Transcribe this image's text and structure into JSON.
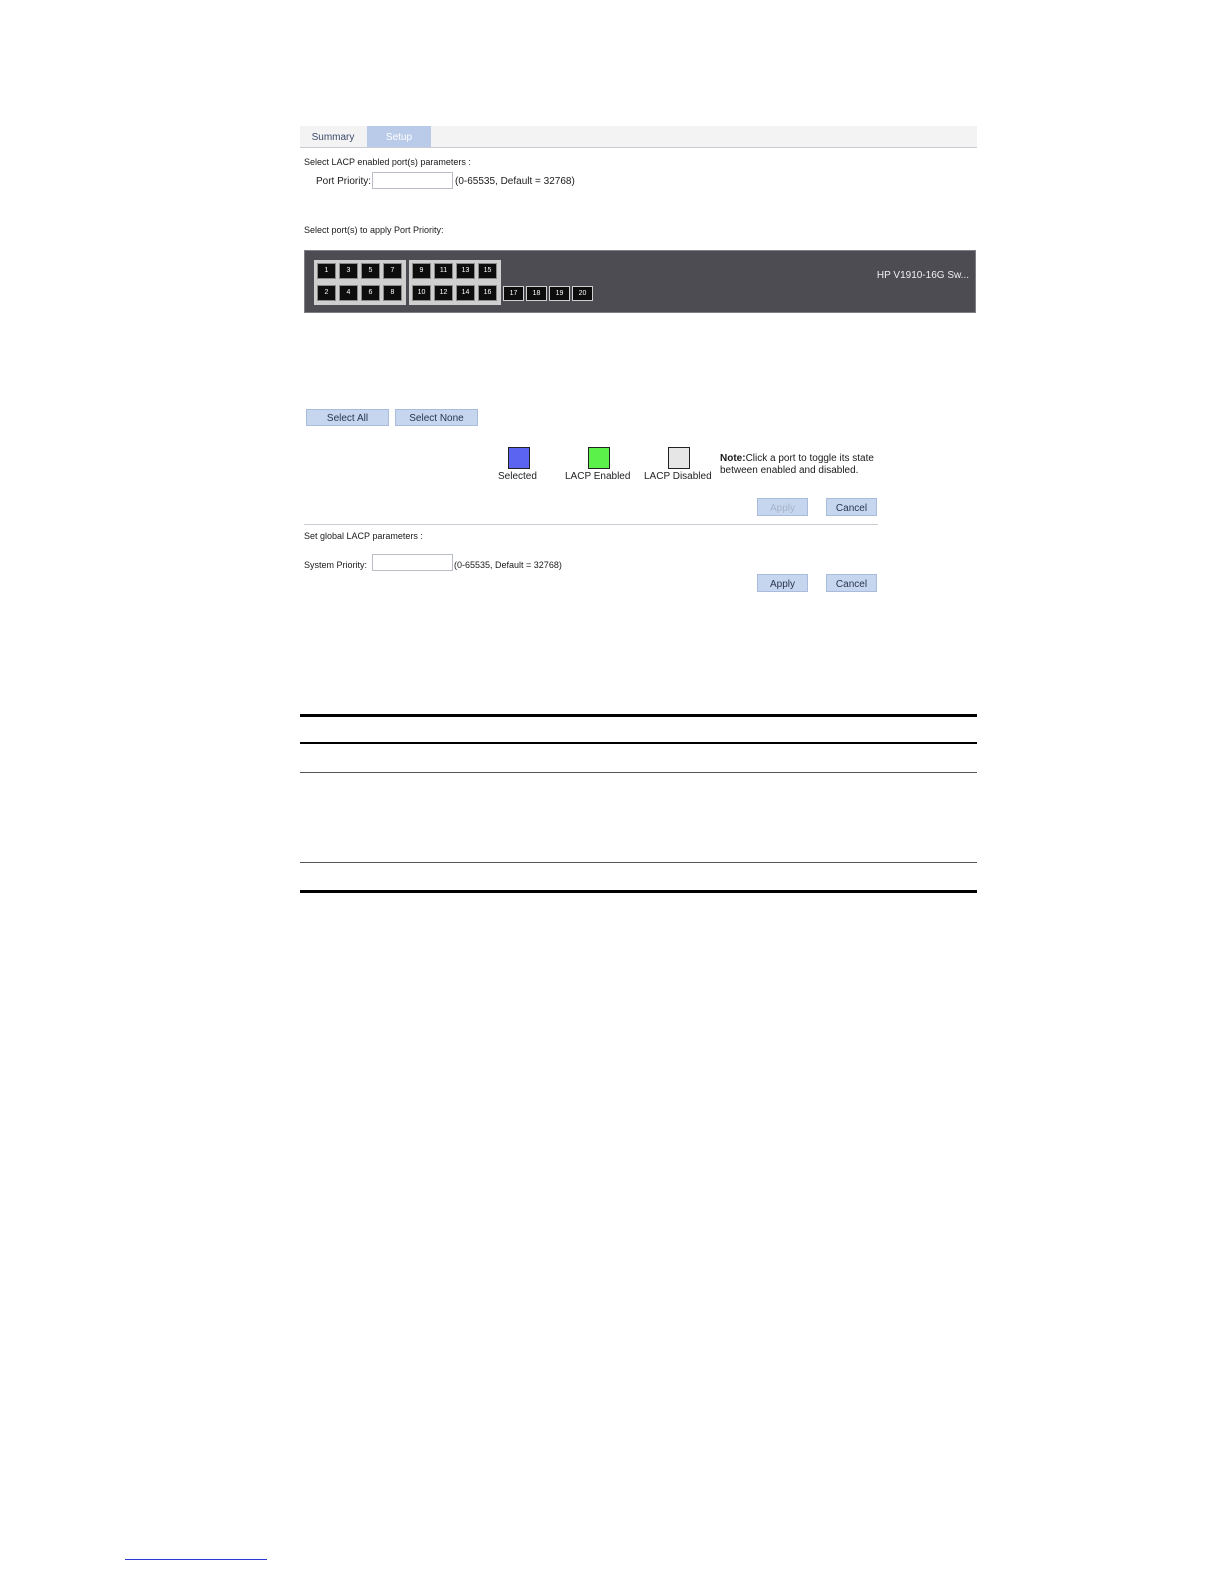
{
  "tabs": [
    {
      "label": "Summary",
      "active": false
    },
    {
      "label": "Setup",
      "active": true
    }
  ],
  "port_params": {
    "heading": "Select LACP enabled port(s) parameters :",
    "label": "Port Priority:",
    "value": "",
    "hint": "(0-65535, Default = 32768)"
  },
  "port_select": {
    "heading": "Select port(s) to apply Port Priority:",
    "device_name": "HP V1910-16G Sw...",
    "groups": [
      {
        "top": [
          "1",
          "3",
          "5",
          "7"
        ],
        "bottom": [
          "2",
          "4",
          "6",
          "8"
        ]
      },
      {
        "top": [
          "9",
          "11",
          "13",
          "15"
        ],
        "bottom": [
          "10",
          "12",
          "14",
          "16"
        ]
      }
    ],
    "sfp_ports": [
      "17",
      "18",
      "19",
      "20"
    ]
  },
  "selection_buttons": {
    "select_all": "Select All",
    "select_none": "Select None"
  },
  "legend": {
    "items": [
      {
        "label": "Selected",
        "color": "#5a64f0"
      },
      {
        "label": "LACP Enabled",
        "color": "#5cf04a"
      },
      {
        "label": "LACP Disabled",
        "color": "#e6e6e6"
      }
    ],
    "note_bold": "Note:",
    "note_line1": "Click a port to toggle its state",
    "note_line2": "between enabled and disabled."
  },
  "port_actions": {
    "apply": "Apply",
    "cancel": "Cancel"
  },
  "global_params": {
    "heading": "Set global LACP parameters :",
    "label": "System Priority:",
    "value": "",
    "hint": "(0-65535, Default = 32768)",
    "apply": "Apply",
    "cancel": "Cancel"
  }
}
